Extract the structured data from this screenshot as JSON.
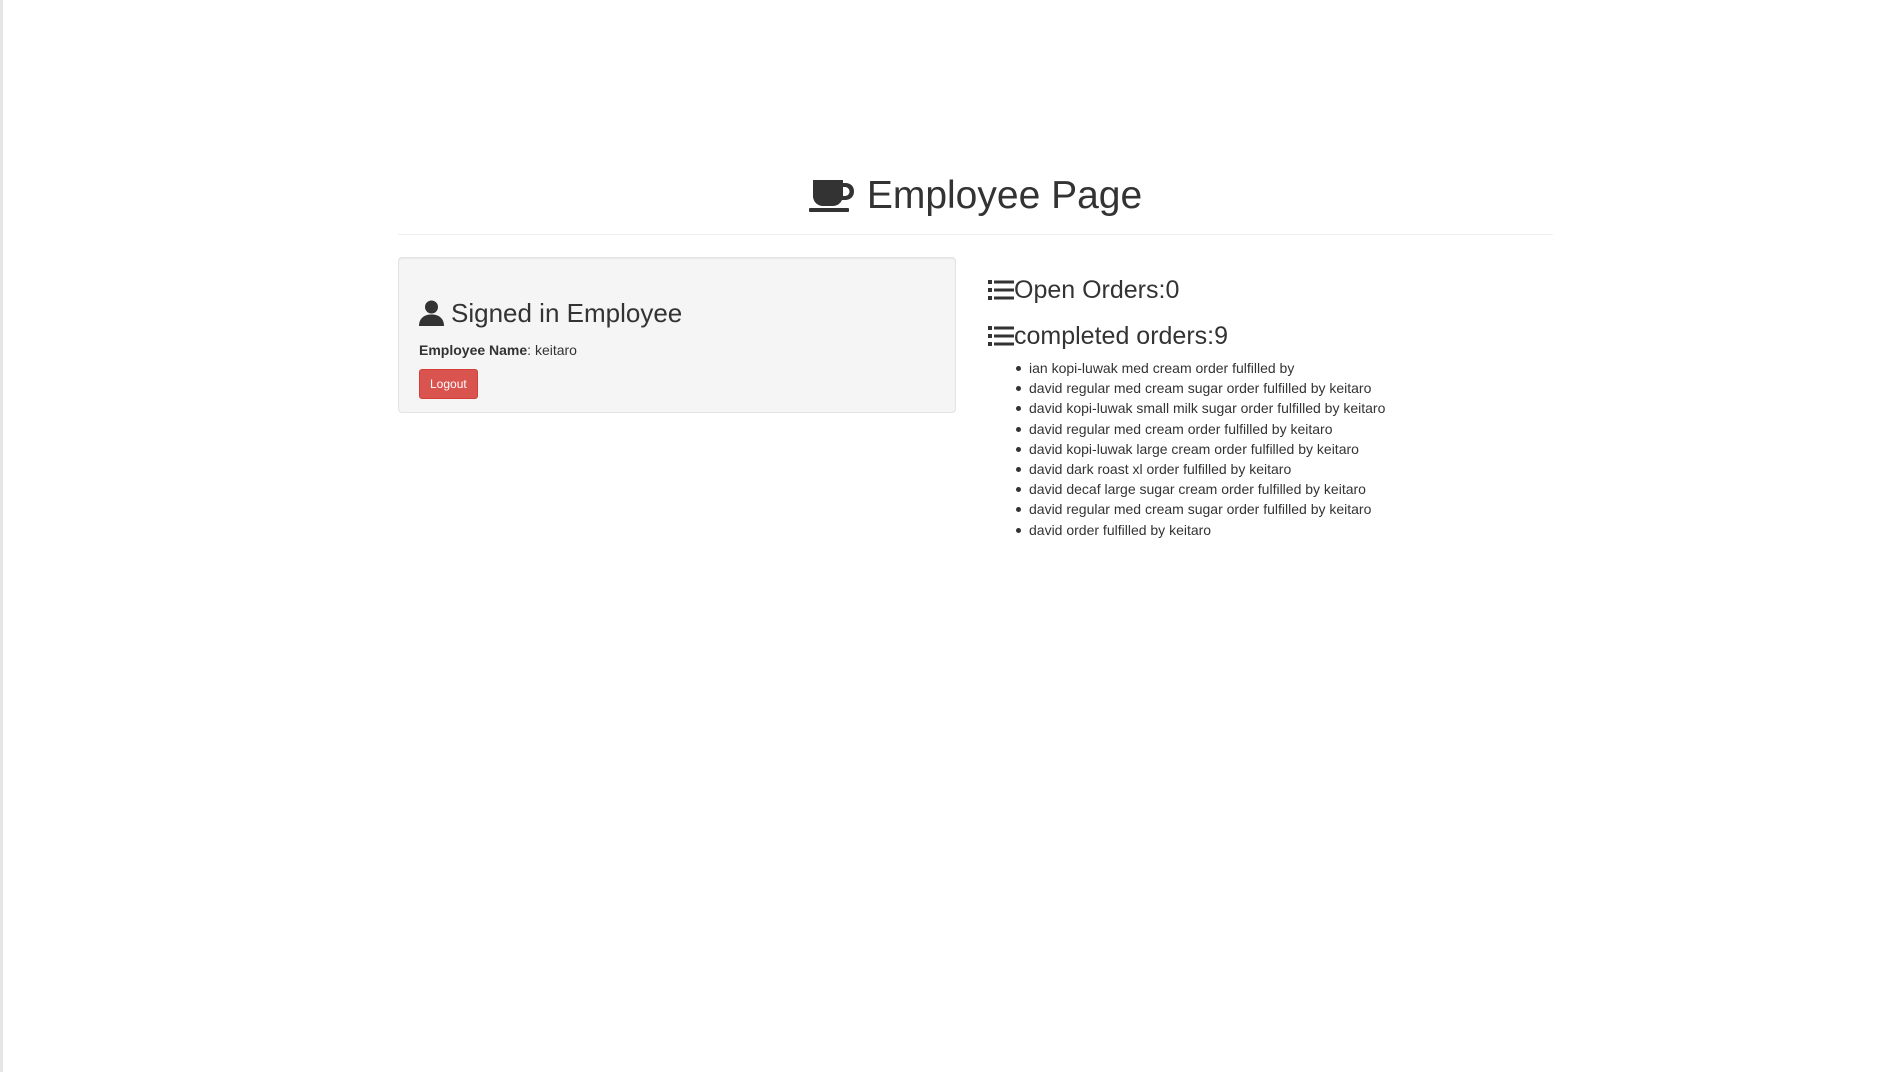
{
  "header": {
    "title": "Employee Page",
    "icon": "coffee-cup-icon"
  },
  "employee_panel": {
    "icon": "user-icon",
    "title": "Signed in Employee",
    "name_label": "Employee Name",
    "name_value": ": keitaro",
    "logout_label": "Logout",
    "logout_color": "#d9534f"
  },
  "open_orders": {
    "icon": "list-icon",
    "label": "Open Orders:0"
  },
  "completed_orders": {
    "icon": "list-icon",
    "label": "completed orders:9",
    "items": [
      "ian kopi-luwak med cream order fulfilled by",
      "david regular med cream sugar order fulfilled by keitaro",
      "david kopi-luwak small milk sugar order fulfilled by keitaro",
      "david regular med cream order fulfilled by keitaro",
      "david kopi-luwak large cream order fulfilled by keitaro",
      "david dark roast xl order fulfilled by keitaro",
      "david decaf large sugar cream order fulfilled by keitaro",
      "david regular med cream sugar order fulfilled by keitaro",
      "david order fulfilled by keitaro"
    ]
  }
}
